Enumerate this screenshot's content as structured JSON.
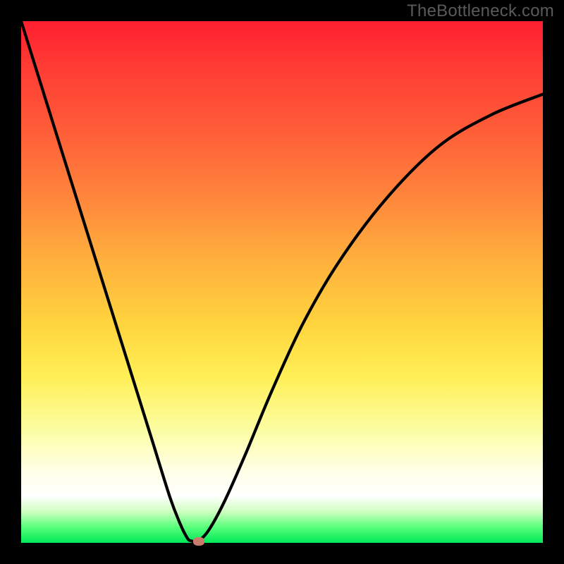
{
  "watermark": "TheBottleneck.com",
  "chart_data": {
    "type": "line",
    "title": "",
    "xlabel": "",
    "ylabel": "",
    "xlim": [
      0,
      1
    ],
    "ylim": [
      0,
      1
    ],
    "series": [
      {
        "name": "bottleneck-curve",
        "x": [
          0.0,
          0.05,
          0.1,
          0.15,
          0.2,
          0.25,
          0.285,
          0.305,
          0.318,
          0.325,
          0.34,
          0.36,
          0.39,
          0.43,
          0.48,
          0.54,
          0.61,
          0.7,
          0.8,
          0.9,
          1.0
        ],
        "y": [
          1.0,
          0.84,
          0.68,
          0.52,
          0.36,
          0.2,
          0.088,
          0.036,
          0.01,
          0.004,
          0.004,
          0.025,
          0.08,
          0.17,
          0.29,
          0.42,
          0.54,
          0.66,
          0.76,
          0.82,
          0.86
        ]
      }
    ],
    "marker": {
      "x": 0.34,
      "y": 0.003
    },
    "gradient_stops": [
      {
        "pos": 0.0,
        "color": "#ff1f2f"
      },
      {
        "pos": 0.45,
        "color": "#ffad3d"
      },
      {
        "pos": 0.68,
        "color": "#ffef55"
      },
      {
        "pos": 0.91,
        "color": "#ffffff"
      },
      {
        "pos": 1.0,
        "color": "#00e85a"
      }
    ]
  }
}
